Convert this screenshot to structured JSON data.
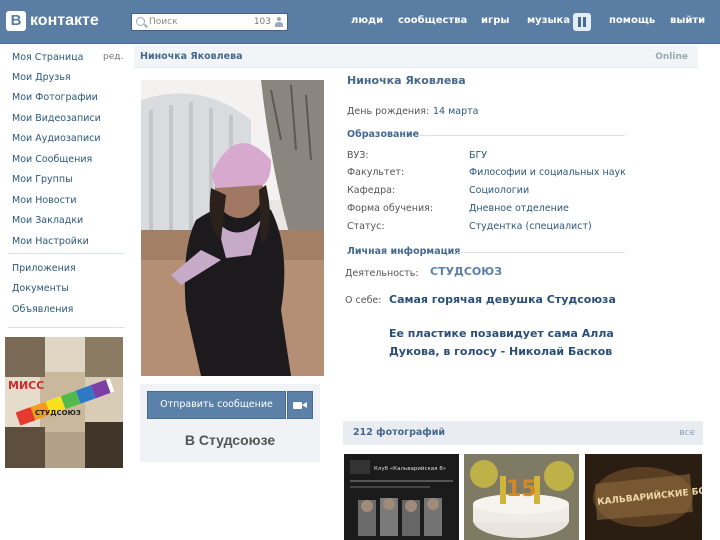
{
  "header": {
    "logo_letter": "В",
    "logo_text": "контакте",
    "search_placeholder": "Поиск",
    "search_count": "103",
    "nav": [
      "люди",
      "сообщества",
      "игры",
      "музыка",
      "помощь",
      "выйти"
    ]
  },
  "sidebar": {
    "edit_label": "ред.",
    "items": [
      "Моя Страница",
      "Мои Друзья",
      "Мои Фотографии",
      "Мои Видеозаписи",
      "Мои Аудиозаписи",
      "Мои Сообщения",
      "Мои Группы",
      "Мои Новости",
      "Мои Закладки",
      "Мои Настройки"
    ],
    "extra_items": [
      "Приложения",
      "Документы",
      "Объявления"
    ],
    "ad_text": [
      "МИСС",
      "СТУДСОЮЗ"
    ]
  },
  "profile": {
    "bar_name": "Ниночка Яковлева",
    "status": "Online",
    "full_name": "Ниночка  Яковлева",
    "birthday_label": "День рождения:",
    "birthday_value": "14 марта",
    "education_title": "Образование",
    "education": [
      {
        "label": "ВУЗ:",
        "value": "БГУ"
      },
      {
        "label": "Факультет:",
        "value": "Философии и социальных наук"
      },
      {
        "label": "Кафедра:",
        "value": "Социологии"
      },
      {
        "label": "Форма обучения:",
        "value": "Дневное отделение"
      },
      {
        "label": "Статус:",
        "value": "Студентка (специалист)"
      }
    ],
    "personal_title": "Личная информация",
    "activity_label": "Деятельность:",
    "activity_value": "СТУДСОЮЗ",
    "about_label": "О себе:",
    "about_p1": "Самая горячая девушка Студсоюза",
    "about_p2": "Ее пластике позавидует сама Алла Дукова, в голосу - Николай Басков",
    "send_message": "Отправить сообщение",
    "group_caption": "В Студсоюзе"
  },
  "photos": {
    "title": "212 фотографий",
    "all_link": "все",
    "thumb1_text": [
      "Клуб «Кальварийская 8»"
    ],
    "thumb2_text": "15",
    "thumb3_text": "КАЛЬВАРИЙСКИЕ БОБРЫ"
  },
  "colors": {
    "header_bg": "#597da3",
    "link": "#2b587a",
    "accent": "#45688e"
  }
}
